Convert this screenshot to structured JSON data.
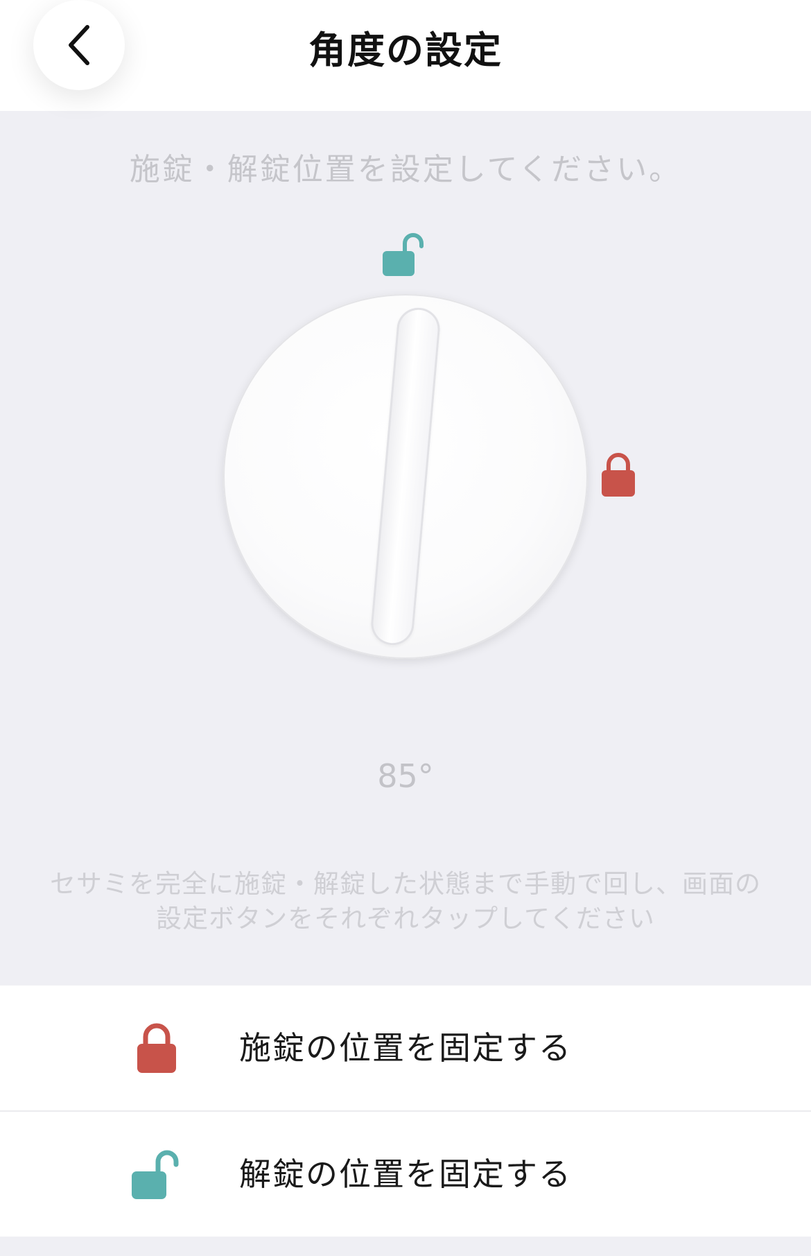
{
  "header": {
    "title": "角度の設定",
    "back_icon": "chevron-left-icon"
  },
  "main": {
    "instruction": "施錠・解錠位置を設定してください。",
    "angle_label": "85°",
    "help_line1": "セサミを完全に施錠・解錠した状態まで手動で回し、画面の",
    "help_line2": "設定ボタンをそれぞれタップしてください"
  },
  "actions": [
    {
      "label": "施錠の位置を固定する",
      "icon": "lock-icon"
    },
    {
      "label": "解錠の位置を固定する",
      "icon": "unlock-icon"
    }
  ],
  "colors": {
    "lock": "#c8534a",
    "unlock": "#5ab0ae",
    "background": "#efeff4"
  }
}
